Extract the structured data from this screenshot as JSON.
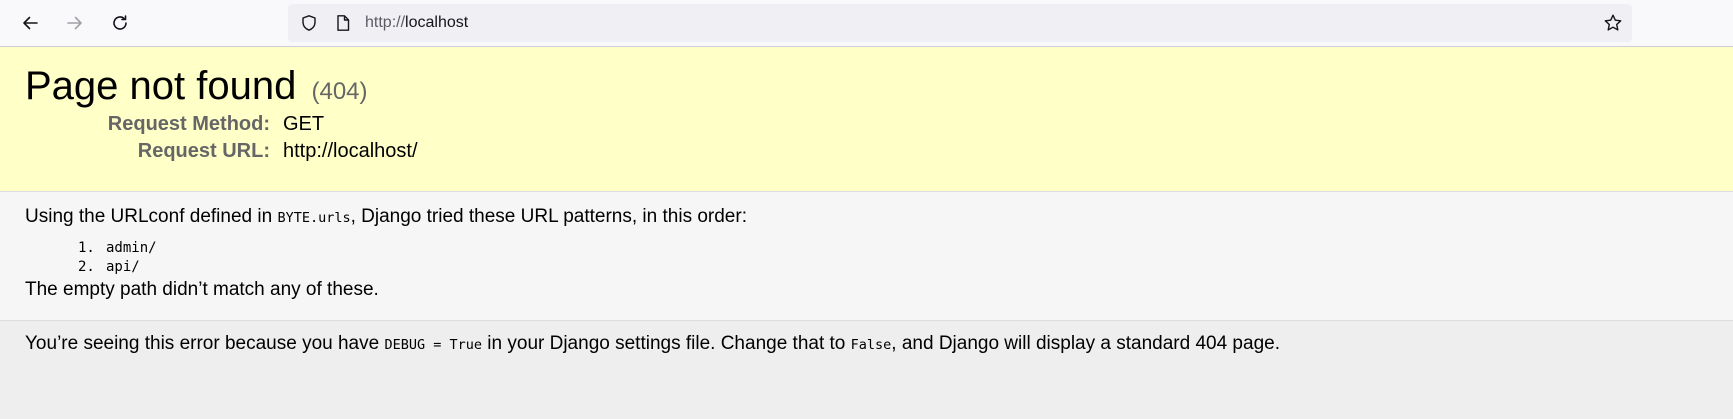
{
  "browser": {
    "url_prefix": "http://",
    "url_host": "localhost"
  },
  "summary": {
    "title": "Page not found",
    "code": "(404)",
    "request_method_label": "Request Method:",
    "request_method_value": "GET",
    "request_url_label": "Request URL:",
    "request_url_value": "http://localhost/"
  },
  "info": {
    "intro_before": "Using the URLconf defined in ",
    "intro_code": "BYTE.urls",
    "intro_after": ", Django tried these URL patterns, in this order:",
    "patterns": [
      {
        "num": "1.",
        "pattern": "admin/"
      },
      {
        "num": "2.",
        "pattern": "api/"
      }
    ],
    "no_match": "The empty path didn’t match any of these."
  },
  "explanation": {
    "part1": "You’re seeing this error because you have ",
    "code1": "DEBUG = True",
    "part2": " in your Django settings file. Change that to ",
    "code2": "False",
    "part3": ", and Django will display a standard 404 page."
  }
}
